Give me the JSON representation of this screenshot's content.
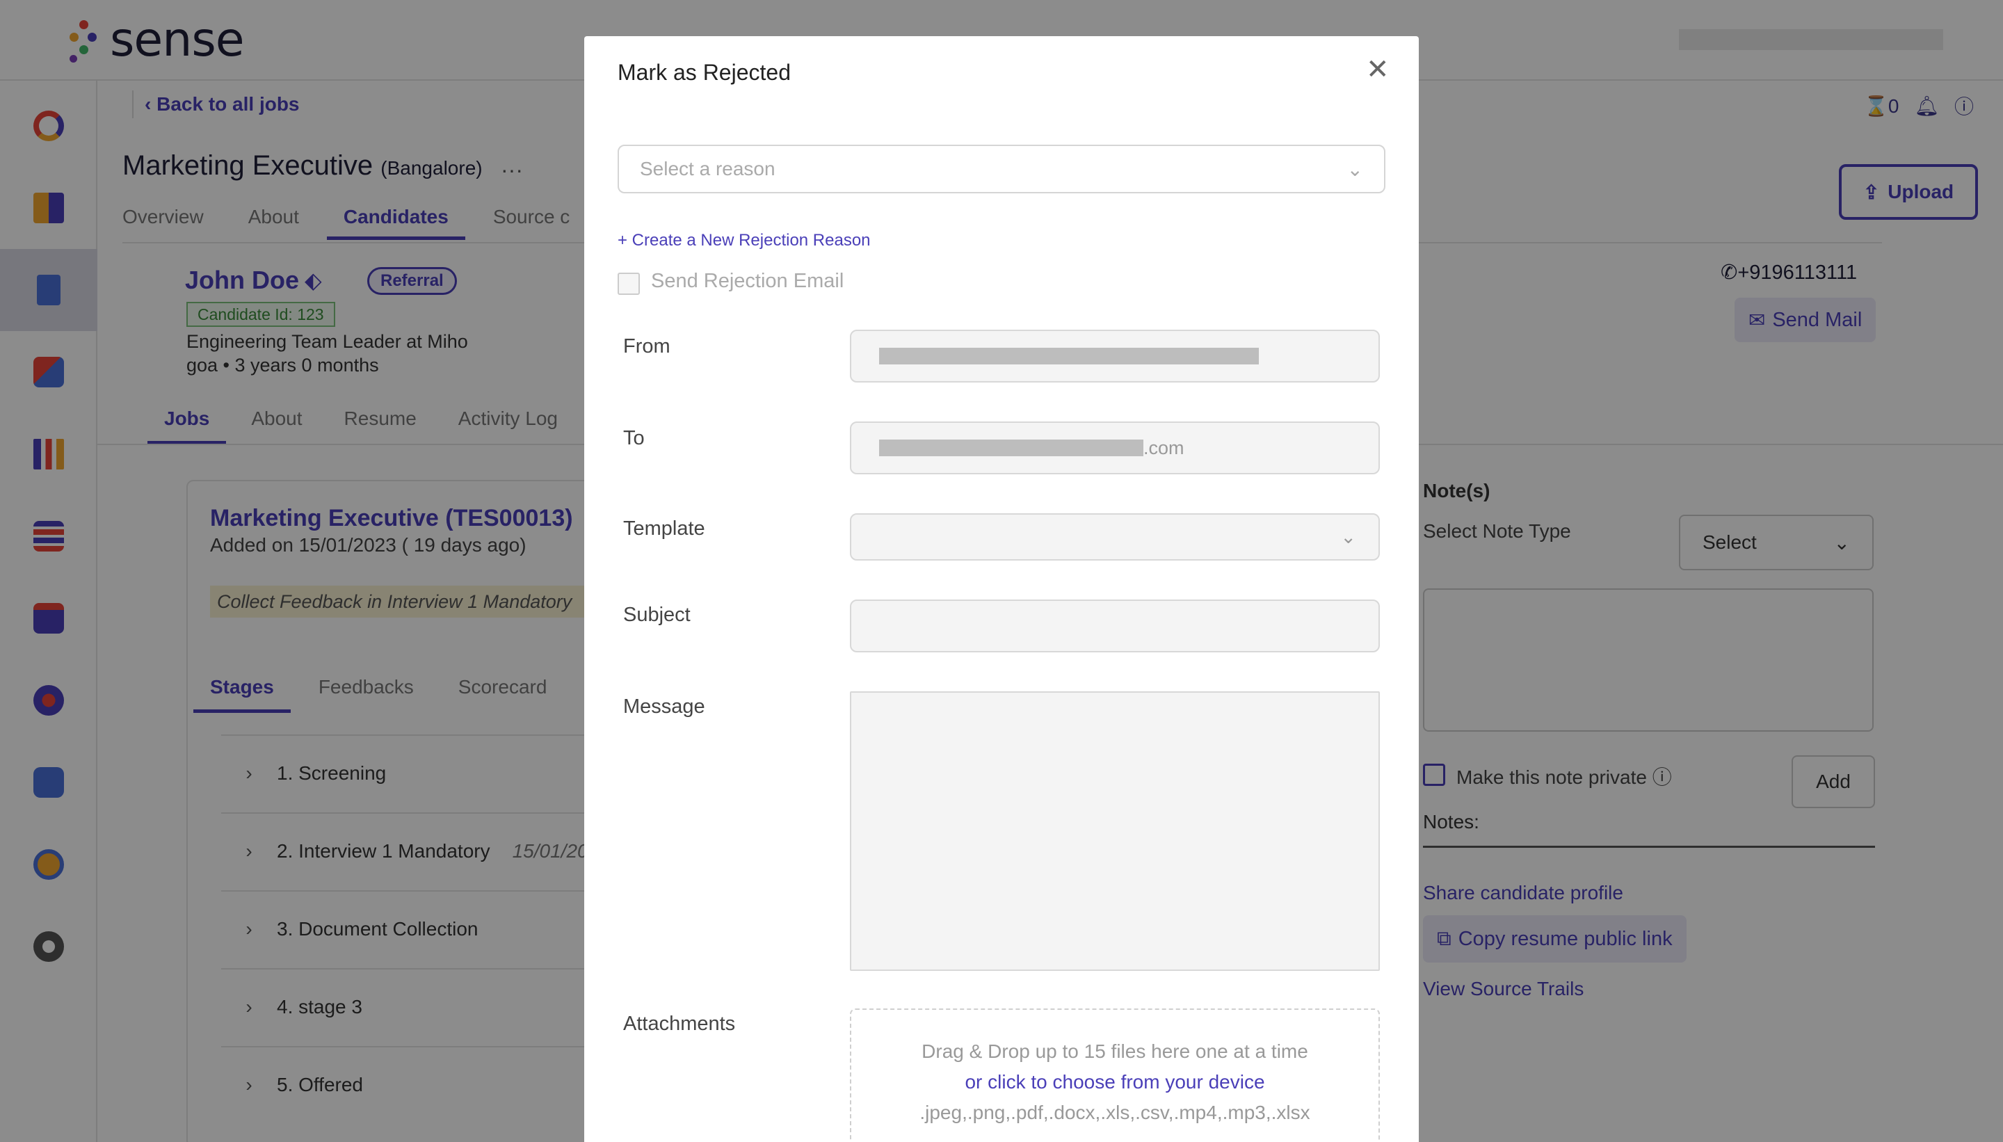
{
  "app": {
    "brand": "sense"
  },
  "header": {
    "back_link": "Back to all jobs",
    "notification_count": "0"
  },
  "job": {
    "title": "Marketing Executive",
    "location": "(Bangalore)",
    "tabs": [
      "Overview",
      "About",
      "Candidates",
      "Source c"
    ],
    "active_tab": "Candidates",
    "upload_label": "Upload"
  },
  "candidate": {
    "name": "John Doe",
    "badge": "Referral",
    "id_label": "Candidate Id: 123",
    "role": "Engineering Team Leader at Miho",
    "location_exp": "goa • 3 years 0 months",
    "phone": "+9196113111",
    "send_mail": "Send Mail",
    "tabs": [
      "Jobs",
      "About",
      "Resume",
      "Activity Log"
    ]
  },
  "job_card": {
    "title": "Marketing Executive (TES00013)",
    "added": "Added on 15/01/2023 ( 19 days ago)",
    "feedback": "Collect Feedback in Interview 1 Mandatory",
    "tabs": [
      "Stages",
      "Feedbacks",
      "Scorecard"
    ],
    "stages": [
      {
        "label": "1. Screening",
        "date": ""
      },
      {
        "label": "2. Interview 1 Mandatory",
        "date": "15/01/20"
      },
      {
        "label": "3. Document Collection",
        "date": ""
      },
      {
        "label": "4. stage 3",
        "date": ""
      },
      {
        "label": "5. Offered",
        "date": ""
      }
    ]
  },
  "notes": {
    "title": "Note(s)",
    "type_label": "Select Note Type",
    "type_value": "Select",
    "private_label": "Make this note private",
    "add_label": "Add",
    "notes_label": "Notes:",
    "share_link": "Share candidate profile",
    "copy_link": "Copy resume public link",
    "source_link": "View Source Trails"
  },
  "modal": {
    "title": "Mark as Rejected",
    "reason_placeholder": "Select a reason",
    "create_reason": "+ Create a New Rejection Reason",
    "send_email_label": "Send Rejection Email",
    "from_label": "From",
    "to_label": "To",
    "to_suffix": ".com",
    "template_label": "Template",
    "subject_label": "Subject",
    "message_label": "Message",
    "attachments_label": "Attachments",
    "drop_text": "Drag & Drop up to 15 files here one at a time",
    "choose_text": "or click to choose from your device",
    "formats_text": ".jpeg,.png,.pdf,.docx,.xls,.csv,.mp4,.mp3,.xlsx"
  },
  "colors": {
    "accent": "#4a3fb8",
    "overlay": "rgba(0,0,0,0.45)"
  }
}
